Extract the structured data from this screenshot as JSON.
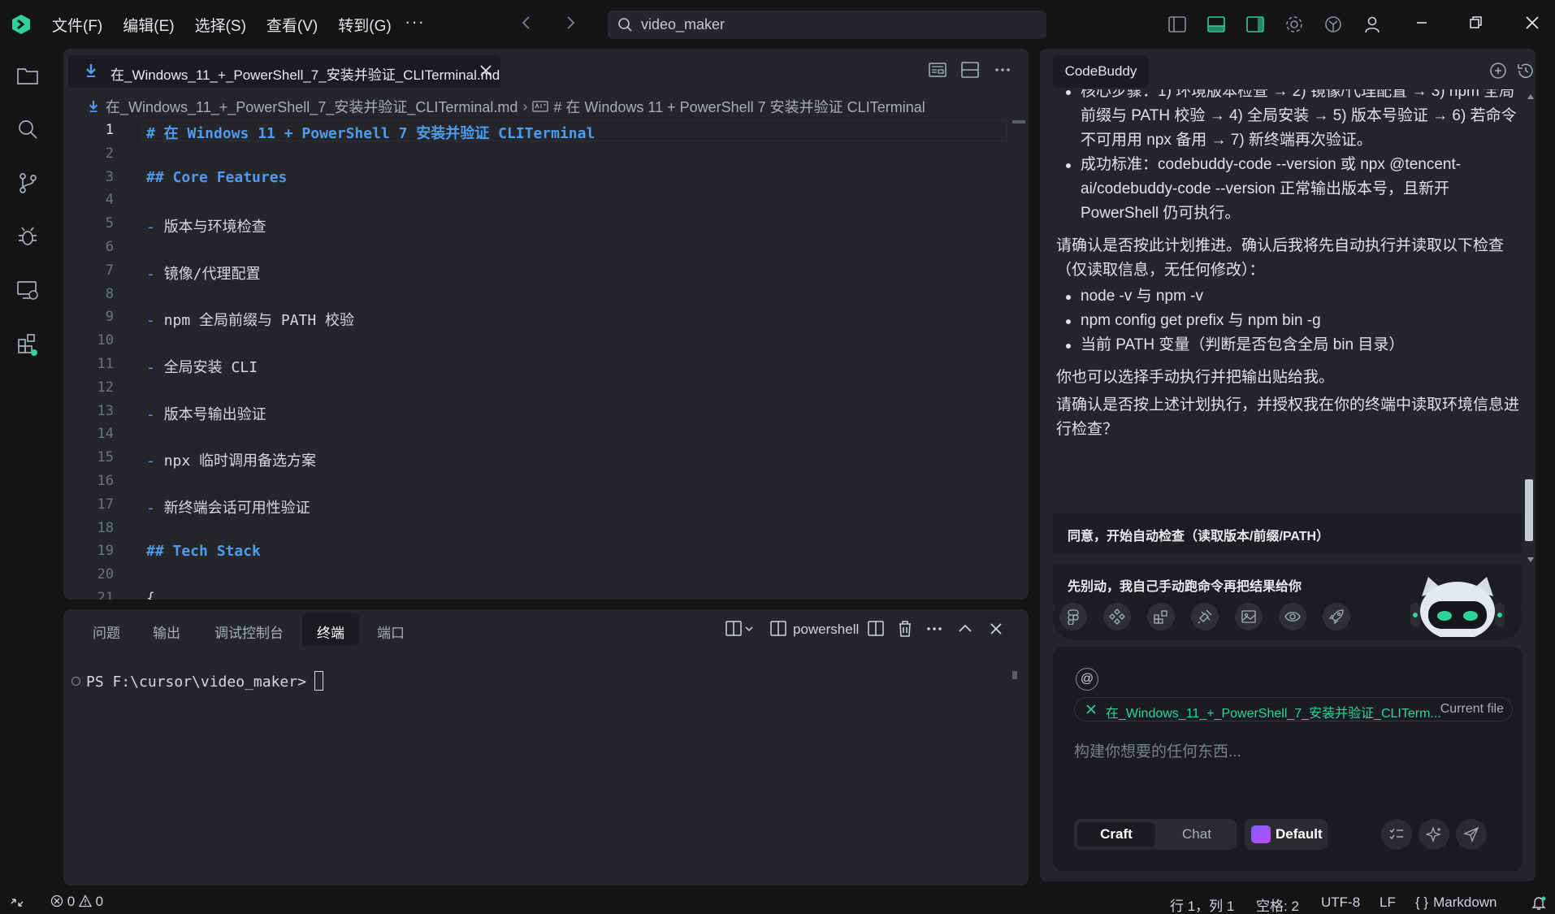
{
  "menu": [
    "文件(F)",
    "编辑(E)",
    "选择(S)",
    "查看(V)",
    "转到(G)"
  ],
  "menu_more": "···",
  "search": {
    "text": "video_maker"
  },
  "editor": {
    "tab_label": "在_Windows_11_+_PowerShell_7_安装并验证_CLITerminal.md",
    "breadcrumb": {
      "file": "在_Windows_11_+_PowerShell_7_安装并验证_CLITerminal.md",
      "symbol": "# 在 Windows 11 + PowerShell 7 安装并验证 CLITerminal"
    },
    "active_line": 1,
    "lines": [
      {
        "n": "1",
        "text": "# 在 Windows 11 + PowerShell 7 安装并验证 CLITerminal",
        "kind": "heading"
      },
      {
        "n": "2",
        "text": "",
        "kind": "plain"
      },
      {
        "n": "3",
        "text": "## Core Features",
        "kind": "heading"
      },
      {
        "n": "4",
        "text": "",
        "kind": "plain"
      },
      {
        "n": "5",
        "text": "版本与环境检查",
        "kind": "list"
      },
      {
        "n": "6",
        "text": "",
        "kind": "plain"
      },
      {
        "n": "7",
        "text": "镜像/代理配置",
        "kind": "list"
      },
      {
        "n": "8",
        "text": "",
        "kind": "plain"
      },
      {
        "n": "9",
        "text": "npm 全局前缀与 PATH 校验",
        "kind": "list"
      },
      {
        "n": "10",
        "text": "",
        "kind": "plain"
      },
      {
        "n": "11",
        "text": "全局安装 CLI",
        "kind": "list"
      },
      {
        "n": "12",
        "text": "",
        "kind": "plain"
      },
      {
        "n": "13",
        "text": "版本号输出验证",
        "kind": "list"
      },
      {
        "n": "14",
        "text": "",
        "kind": "plain"
      },
      {
        "n": "15",
        "text": "npx 临时调用备选方案",
        "kind": "list"
      },
      {
        "n": "16",
        "text": "",
        "kind": "plain"
      },
      {
        "n": "17",
        "text": "新终端会话可用性验证",
        "kind": "list"
      },
      {
        "n": "18",
        "text": "",
        "kind": "plain"
      },
      {
        "n": "19",
        "text": "## Tech Stack",
        "kind": "heading"
      },
      {
        "n": "20",
        "text": "",
        "kind": "plain"
      },
      {
        "n": "21",
        "text": "{",
        "kind": "plain"
      }
    ]
  },
  "panel": {
    "tabs": [
      "问题",
      "输出",
      "调试控制台",
      "终端",
      "端口"
    ],
    "active_tab": "终端",
    "terminal_name": "powershell",
    "prompt_line": "PS F:\\cursor\\video_maker>"
  },
  "side": {
    "tab_label": "CodeBuddy",
    "messages": {
      "partial_top": "核心步骤：1) 环境版本检查 → 2) 镜像/代理配置 → 3) npm 全局前缀与 PATH 校验 → 4) 全局安装 → 5) 版本号验证 → 6) 若命令不可用用 npx 备用 → 7) 新终端再次验证。",
      "success": "成功标准：codebuddy-code --version 或 npx @tencent-ai/codebuddy-code --version 正常输出版本号，且新开 PowerShell 仍可执行。",
      "confirm": "请确认是否按此计划推进。确认后我将先自动执行并读取以下检查（仅读取信息，无任何修改）：",
      "checks": [
        "node -v 与 npm -v",
        "npm config get prefix 与 npm bin -g",
        "当前 PATH 变量（判断是否包含全局 bin 目录）"
      ],
      "manual": "你也可以选择手动执行并把输出贴给我。",
      "authorize": "请确认是否按上述计划执行，并授权我在你的终端中读取环境信息进行检查？"
    },
    "choices": [
      "同意，开始自动检查（读取版本/前缀/PATH）",
      "先别动，我自己手动跑命令再把结果给你"
    ],
    "input": {
      "at_symbol": "@",
      "file_chip": "在_Windows_11_+_PowerShell_7_安装并验证_CLITerm...",
      "file_chip_tag": "Current file",
      "placeholder": "构建你想要的任何东西...",
      "mode_craft": "Craft",
      "mode_chat": "Chat",
      "model": "Default"
    }
  },
  "status": {
    "errors": "0",
    "warnings": "0",
    "position": "行 1，列 1",
    "spaces": "空格: 2",
    "encoding": "UTF-8",
    "eol": "LF",
    "language": "Markdown"
  },
  "colors": {
    "accent_green": "#2fd39a",
    "heading_blue": "#4e9bf0",
    "background": "#141517",
    "panel": "#24262a"
  }
}
